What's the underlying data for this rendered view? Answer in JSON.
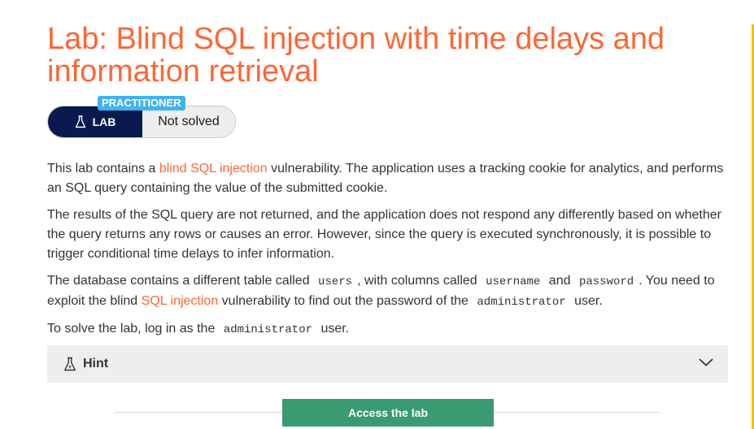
{
  "lab": {
    "title": "Lab: Blind SQL injection with time delays and information retrieval",
    "level_badge": "PRACTITIONER",
    "lab_label": "LAB",
    "status": "Not solved"
  },
  "description": {
    "p1": {
      "before": "This lab contains a ",
      "link": "blind SQL injection",
      "after": " vulnerability. The application uses a tracking cookie for analytics, and performs an SQL query containing the value of the submitted cookie."
    },
    "p2": "The results of the SQL query are not returned, and the application does not respond any differently based on whether the query returns any rows or causes an error. However, since the query is executed synchronously, it is possible to trigger conditional time delays to infer information.",
    "p3": {
      "t1": "The database contains a different table called ",
      "c1": "users",
      "t2": ", with columns called ",
      "c2": "username",
      "t3": " and ",
      "c3": "password",
      "t4": ". You need to exploit the blind ",
      "link": "SQL injection",
      "t5": " vulnerability to find out the password of the ",
      "c4": "administrator",
      "t6": " user."
    },
    "p4": {
      "t1": "To solve the lab, log in as the ",
      "c1": "administrator",
      "t2": " user."
    }
  },
  "hint": {
    "label": "Hint",
    "icon": "flask-icon"
  },
  "access_button": {
    "label": "Access the lab"
  },
  "colors": {
    "accent": "#ff6633",
    "badge": "#3fb3f1",
    "lab_pill": "#0a1a4e",
    "access_button": "#3a9a72"
  }
}
